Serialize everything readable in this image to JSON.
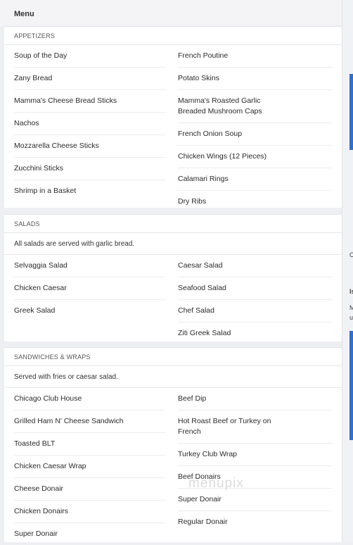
{
  "header": {
    "title": "Menu"
  },
  "sections": {
    "appetizers": {
      "title": "APPETIZERS",
      "left": [
        "Soup of the Day",
        "Zany Bread",
        "Mamma's Cheese Bread Sticks",
        "Nachos",
        "Mozzarella Cheese Sticks",
        "Zucchini Sticks",
        "Shrimp in a Basket"
      ],
      "right": [
        "French Poutine",
        "Potato Skins",
        "Mamma's Roasted Garlic Breaded Mushroom Caps",
        "French Onion Soup",
        "Chicken Wings (12 Pieces)",
        "Calamari Rings",
        "Dry Ribs"
      ]
    },
    "salads": {
      "title": "SALADS",
      "note": "All salads are served with garlic bread.",
      "left": [
        "Selvaggia Salad",
        "Chicken Caesar",
        "Greek Salad"
      ],
      "right": [
        "Caesar Salad",
        "Seafood Salad",
        "Chef Salad",
        "Ziti Greek Salad"
      ]
    },
    "sandwiches": {
      "title": "SANDWICHES & WRAPS",
      "note": "Served with fries or caesar salad.",
      "left": [
        "Chicago Club House",
        "Grilled Ham N' Cheese Sandwich",
        "Toasted BLT",
        "Chicken Caesar Wrap",
        "Cheese Donair",
        "Chicken Donairs",
        "Super Donair"
      ],
      "right": [
        "Beef Dip",
        "Hot Roast Beef or Turkey on French",
        "Turkey Club Wrap",
        "Beef Donairs",
        "Super Donair",
        "Regular Donair"
      ]
    }
  },
  "side_strip": {
    "letters": [
      "C",
      "Is",
      "M",
      "u"
    ]
  },
  "watermark": "menupix",
  "colors": {
    "accent": "#2f6fd1",
    "background": "#eeeff3",
    "card": "#ffffff"
  }
}
